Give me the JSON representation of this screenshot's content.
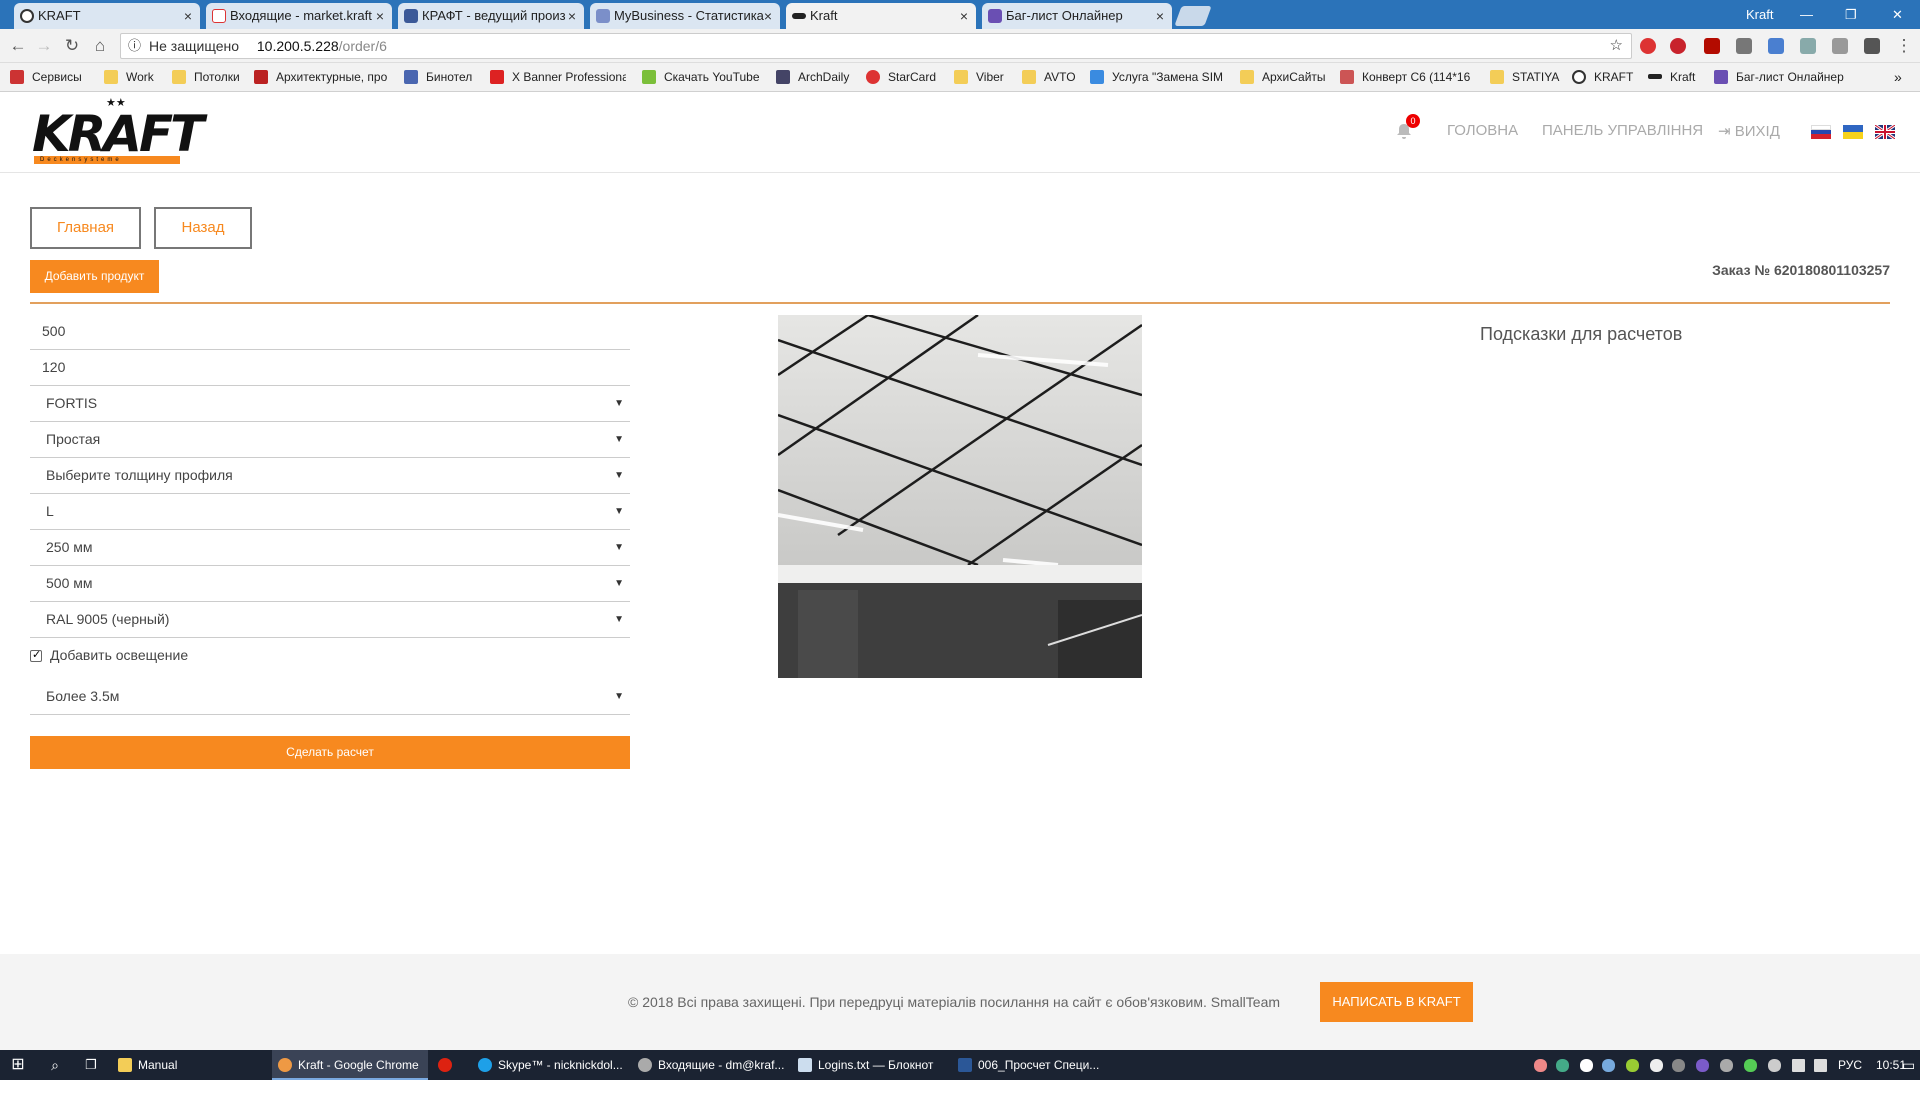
{
  "browser": {
    "tabs": [
      {
        "label": "KRAFT",
        "active": false
      },
      {
        "label": "Входящие - market.kraft",
        "active": false
      },
      {
        "label": "КРАФТ - ведущий произ",
        "active": false
      },
      {
        "label": "MyBusiness - Статистика",
        "active": false
      },
      {
        "label": "Kraft",
        "active": true
      },
      {
        "label": "Баг-лист Онлайнер",
        "active": false
      }
    ],
    "profile_name": "Kraft",
    "address": {
      "security_label": "Не защищено",
      "host": "10.200.5.228",
      "path": "/order/6"
    },
    "bookmarks": [
      "Сервисы",
      "Work",
      "Потолки",
      "Архитектурные, про",
      "Бинотел",
      "X Banner Professiona",
      "Скачать YouTube",
      "ArchDaily",
      "StarCard",
      "Viber",
      "AVTO",
      "Услуга \"Замена SIM",
      "АрхиСайты",
      "Конверт C6 (114*16",
      "STATIYA",
      "KRAFT",
      "Kraft",
      "Баг-лист Онлайнер"
    ],
    "bookmarks_more": "»"
  },
  "header": {
    "logo_text": "KRAFT",
    "logo_sub": "Deckensysteme",
    "notifications_count": "0",
    "nav": {
      "home": "ГОЛОВНА",
      "panel": "ПАНЕЛЬ УПРАВЛІННЯ",
      "logout": "ВИХІД"
    },
    "languages": [
      "ru",
      "ua",
      "en"
    ]
  },
  "actions": {
    "main_button": "Главная",
    "back_button": "Назад",
    "add_product_button": "Добавить продукт",
    "order_label": "Заказ № 620180801103257"
  },
  "form": {
    "width_value": "500",
    "height_value": "120",
    "system": "FORTIS",
    "type": "Простая",
    "profile_thickness_placeholder": "Выберите толщину профиля",
    "profile_shape": "L",
    "cell_size_1": "250 мм",
    "cell_size_2": "500 мм",
    "color": "RAL 9005 (черный)",
    "lighting_checkbox_label": "Добавить освещение",
    "lighting_checked": true,
    "length_option": "Более 3.5м",
    "calculate_button": "Сделать расчет"
  },
  "hints": {
    "title": "Подсказки для расчетов"
  },
  "footer": {
    "copyright": "© 2018 Всі права захищені. При передруці матеріалів посилання на сайт є обов'язковим. SmallTeam",
    "write_button": "НАПИСАТЬ В KRAFT"
  },
  "taskbar": {
    "items": [
      "Manual",
      "Kraft - Google Chrome",
      "",
      "Skype™ - nicknickdol...",
      "Входящие - dm@kraf...",
      "Logins.txt — Блокнот",
      "006_Просчет Специ..."
    ],
    "lang": "РУС",
    "time": "10:51"
  },
  "colors": {
    "accent": "#f7891f",
    "tabstrip": "#2b73b9",
    "taskbar": "#1b2332"
  }
}
